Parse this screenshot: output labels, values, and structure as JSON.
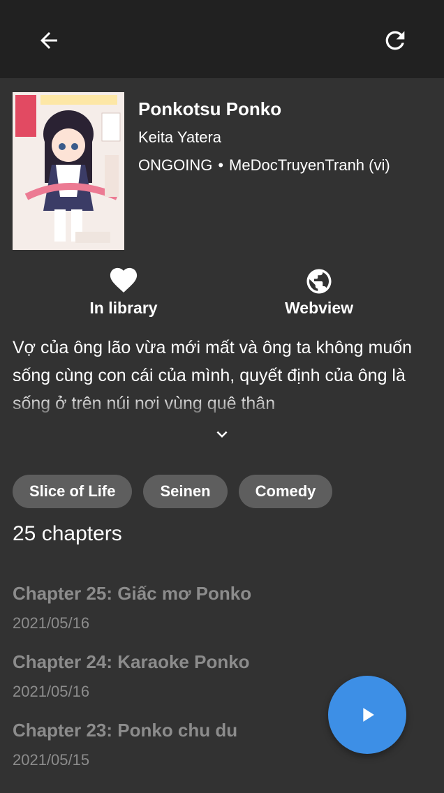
{
  "header": {
    "back_icon": "arrow-back-icon",
    "refresh_icon": "refresh-icon"
  },
  "manga": {
    "title": "Ponkotsu Ponko",
    "author": "Keita Yatera",
    "status": "ONGOING",
    "separator": "•",
    "source": "MeDocTruyenTranh (vi)",
    "description": "Vợ của ông lão vừa mới mất và ông ta không muốn sống cùng con cái của mình, quyết định của ông là sống ở trên núi nơi vùng quê thân"
  },
  "actions": {
    "library": {
      "label": "In library",
      "icon": "heart-icon"
    },
    "webview": {
      "label": "Webview",
      "icon": "globe-icon"
    }
  },
  "genres": [
    "Slice of Life",
    "Seinen",
    "Comedy"
  ],
  "chapter_count": "25 chapters",
  "chapters": [
    {
      "title": "Chapter 25: Giấc mơ Ponko",
      "date": "2021/05/16"
    },
    {
      "title": "Chapter 24: Karaoke Ponko",
      "date": "2021/05/16"
    },
    {
      "title": "Chapter 23: Ponko chu du",
      "date": "2021/05/15"
    }
  ],
  "fab": {
    "icon": "play-icon"
  },
  "colors": {
    "appbar": "#212121",
    "background": "#323232",
    "chip": "#5e5e5e",
    "fab": "#3d8fe6",
    "muted_text": "#8c8c8c"
  }
}
